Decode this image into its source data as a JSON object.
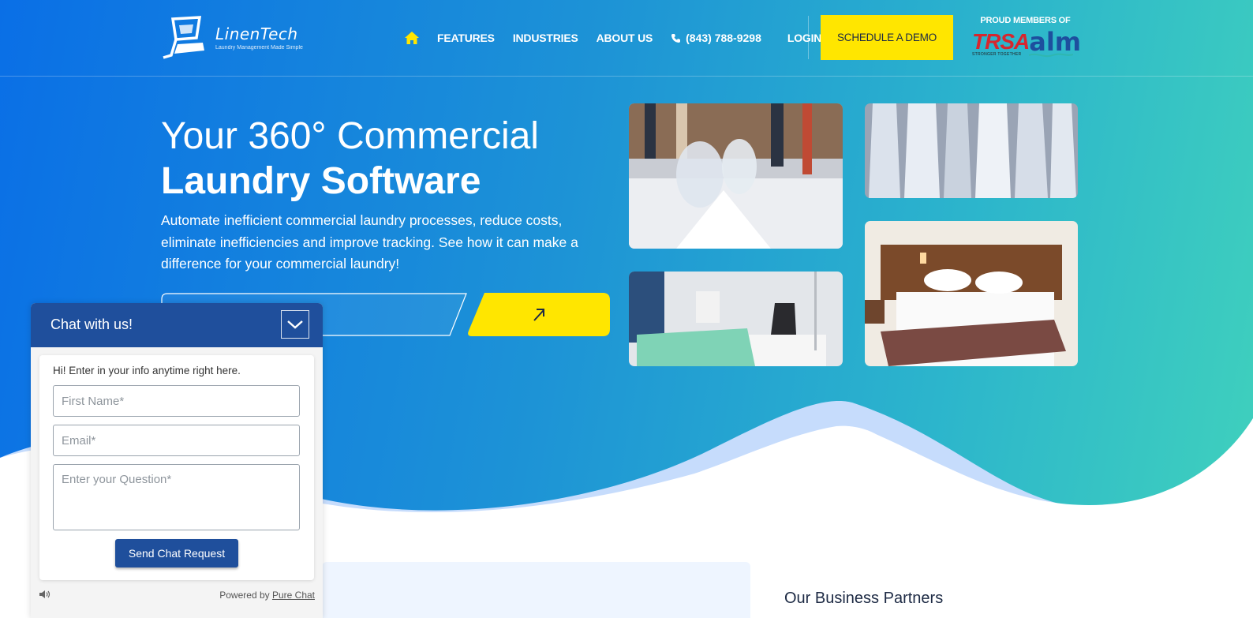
{
  "header": {
    "logo": {
      "name": "LinenTech",
      "tagline": "Laundry Management Made Simple"
    },
    "nav": [
      {
        "key": "features",
        "label": "FEATURES"
      },
      {
        "key": "industries",
        "label": "INDUSTRIES"
      },
      {
        "key": "about",
        "label": "ABOUT US"
      }
    ],
    "phone": "(843) 788-9298",
    "login": "LOGIN",
    "demo_button": "SCHEDULE A DEMO",
    "members": {
      "title": "PROUD MEMBERS OF",
      "trsa": "TRSA",
      "trsa_sub": "STRONGER TOGETHER",
      "alm": "alm"
    }
  },
  "hero": {
    "title_line1": "Your 360° Commercial",
    "title_line2": "Laundry Software",
    "description": "Automate inefficient commercial laundry processes, reduce costs, eliminate inefficiencies and improve tracking. See how it can make a difference for your commercial laundry!",
    "email_placeholder": "",
    "go_icon": "arrow-up-right-icon"
  },
  "partners_title": "Our Business Partners",
  "chat": {
    "title": "Chat with us!",
    "intro": "Hi! Enter in your info anytime right here.",
    "first_name_placeholder": "First Name*",
    "email_placeholder": "Email*",
    "question_placeholder": "Enter your Question*",
    "send_label": "Send Chat Request",
    "powered_prefix": "Powered by",
    "powered_link": "Pure Chat"
  },
  "colors": {
    "accent": "#ffe600",
    "chat_blue": "#1f4f9c",
    "text_dark": "#1d2a44"
  }
}
